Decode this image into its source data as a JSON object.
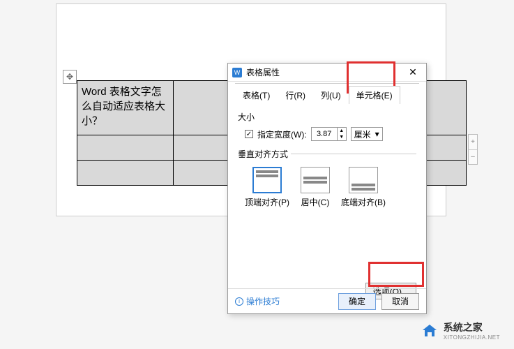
{
  "table": {
    "cell_text": "Word 表格文字怎么自动适应表格大小？"
  },
  "dialog": {
    "title": "表格属性",
    "tabs": {
      "table": "表格(T)",
      "row": "行(R)",
      "column": "列(U)",
      "cell": "单元格(E)"
    },
    "size": {
      "group": "大小",
      "specify_width_label": "指定宽度(W):",
      "width_value": "3.87",
      "unit": "厘米"
    },
    "valign": {
      "group": "垂直对齐方式",
      "top": "顶端对齐(P)",
      "center": "居中(C)",
      "bottom": "底端对齐(B)"
    },
    "options_btn": "选项(O)...",
    "tip": "操作技巧",
    "ok": "确定",
    "cancel": "取消"
  },
  "watermark": {
    "cn": "系统之家",
    "en": "XITONGZHIJIA.NET"
  }
}
